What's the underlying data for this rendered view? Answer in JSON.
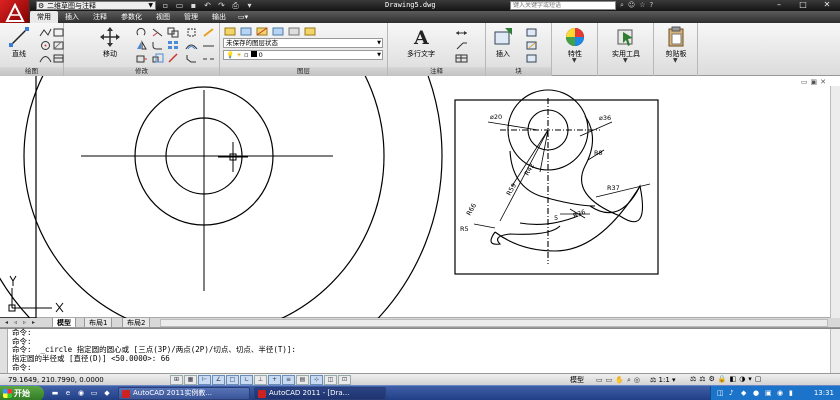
{
  "titlebar": {
    "workspace": "二维草图与注释",
    "document_title": "Drawing5.dwg",
    "search_placeholder": "键入关键字或短语"
  },
  "ribbon": {
    "tabs": [
      "常用",
      "插入",
      "注释",
      "参数化",
      "视图",
      "管理",
      "输出"
    ],
    "active_tab": "常用",
    "panels": {
      "draw": {
        "title": "绘图",
        "line_label": "直线"
      },
      "modify": {
        "title": "修改",
        "move_label": "移动"
      },
      "layers": {
        "title": "图层",
        "layer_state": "未保存的图层状态",
        "current_layer": "0"
      },
      "annotation": {
        "title": "注释",
        "mtext_label": "多行文字"
      },
      "block": {
        "title": "块",
        "insert_label": "插入"
      },
      "properties": {
        "label": "特性"
      },
      "utilities": {
        "label": "实用工具"
      },
      "clipboard": {
        "label": "剪贴板"
      }
    }
  },
  "drawing": {
    "dimensions": {
      "d20": "⌀20",
      "d36": "⌀36",
      "r8": "R8",
      "r37": "R37",
      "r42": "R42",
      "r59": "R59",
      "r66": "R66",
      "r5": "R5",
      "r36": "R36",
      "len5": "5"
    },
    "ucs": {
      "x_label": "X",
      "y_label": "Y"
    }
  },
  "layout_tabs": [
    "模型",
    "布局1",
    "布局2"
  ],
  "active_layout_tab": "模型",
  "command_line": {
    "lines": [
      "命令:",
      "命令:",
      "命令:  _circle 指定圆的圆心或 [三点(3P)/两点(2P)/切点、切点、半径(T)]:",
      "指定圆的半径或 [直径(D)] <50.0000>: 66",
      "命令:"
    ]
  },
  "statusbar": {
    "coordinates": "79.1649,  210.7990,  0.0000",
    "model_label": "模型",
    "annotation_scale": "1:1"
  },
  "taskbar": {
    "start_label": "开始",
    "tasks": [
      "AutoCAD 2011实例教...",
      "AutoCAD 2011 - [Dra..."
    ],
    "clock": "13:31"
  }
}
